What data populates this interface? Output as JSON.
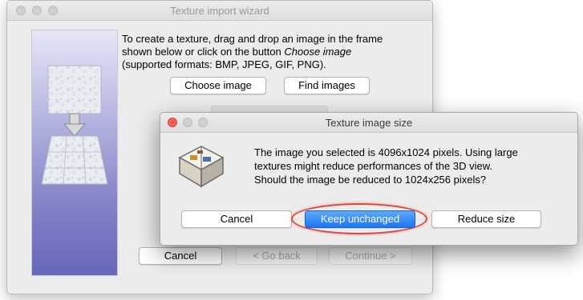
{
  "wizard": {
    "title": "Texture import wizard",
    "instructions": {
      "line1": "To create a texture, drag and drop an image in the frame",
      "line2_prefix": "shown below or click on the button",
      "line2_emphasis": "Choose image",
      "line3": "(supported formats: BMP, JPEG, GIF, PNG)."
    },
    "choose_image_label": "Choose image",
    "find_images_label": "Find images",
    "cancel_label": "Cancel",
    "back_label": "< Go back",
    "continue_label": "Continue >"
  },
  "dialog": {
    "title": "Texture image size",
    "message": {
      "line1": "The image you selected is 4096x1024 pixels. Using large",
      "line2": "textures might reduce performances of the 3D view.",
      "line3": "Should the image be reduced to 1024x256 pixels?"
    },
    "cancel_label": "Cancel",
    "keep_label": "Keep unchanged",
    "reduce_label": "Reduce size"
  },
  "colors": {
    "highlight": "#e0463c",
    "primary_button": "#1b76f2",
    "side_panel": "#7373c1"
  },
  "icons": [
    "close-icon",
    "minimize-icon",
    "zoom-icon",
    "texture-image-icon",
    "arrow-down-icon",
    "floor-tiles-icon",
    "sweet-home-3d-icon"
  ]
}
